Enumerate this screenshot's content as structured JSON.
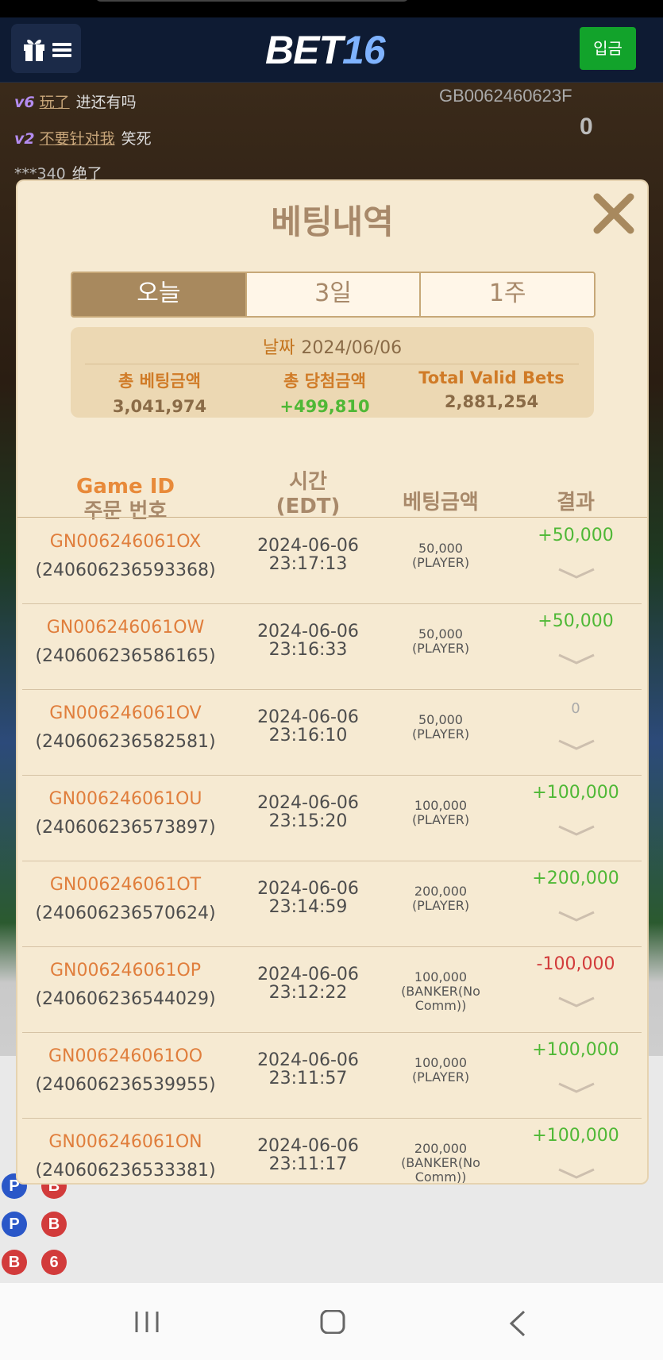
{
  "header": {
    "logo_part1": "BET",
    "logo_part2": "16",
    "deposit_label": "입금"
  },
  "background": {
    "chat": [
      {
        "vip": "v6",
        "name": "玩了",
        "text": "进还有吗"
      },
      {
        "vip": "v2",
        "name": "不要针对我",
        "text": "笑死"
      },
      {
        "vip": "",
        "name": "***340",
        "text": "绝了"
      }
    ],
    "game_code": "GB0062460623F",
    "chip_count": "0"
  },
  "modal": {
    "title": "베팅내역",
    "tabs": [
      {
        "label": "오늘",
        "active": true
      },
      {
        "label": "3일",
        "active": false
      },
      {
        "label": "1주",
        "active": false
      }
    ],
    "summary": {
      "date_label": "날짜",
      "date_value": "2024/06/06",
      "total_bet_label": "총 베팅금액",
      "total_bet_value": "3,041,974",
      "total_win_label": "총 당첨금액",
      "total_win_value": "+499,810",
      "valid_label": "Total Valid Bets",
      "valid_value": "2,881,254"
    },
    "columns": {
      "game_id": "Game ID",
      "order_no": "주문 번호",
      "time": "시간",
      "time_zone": "(EDT)",
      "bet_amount": "베팅금액",
      "result": "결과"
    },
    "rows": [
      {
        "game_id": "GN006246061OX",
        "order": "(240606236593368)",
        "date": "2024-06-06",
        "time": "23:17:13",
        "amount": "50,000",
        "bet_on": "(PLAYER)",
        "bet_on2": "",
        "result": "+50,000",
        "result_type": "pos"
      },
      {
        "game_id": "GN006246061OW",
        "order": "(240606236586165)",
        "date": "2024-06-06",
        "time": "23:16:33",
        "amount": "50,000",
        "bet_on": "(PLAYER)",
        "bet_on2": "",
        "result": "+50,000",
        "result_type": "pos"
      },
      {
        "game_id": "GN006246061OV",
        "order": "(240606236582581)",
        "date": "2024-06-06",
        "time": "23:16:10",
        "amount": "50,000",
        "bet_on": "(PLAYER)",
        "bet_on2": "",
        "result": "0",
        "result_type": "zero"
      },
      {
        "game_id": "GN006246061OU",
        "order": "(240606236573897)",
        "date": "2024-06-06",
        "time": "23:15:20",
        "amount": "100,000",
        "bet_on": "(PLAYER)",
        "bet_on2": "",
        "result": "+100,000",
        "result_type": "pos"
      },
      {
        "game_id": "GN006246061OT",
        "order": "(240606236570624)",
        "date": "2024-06-06",
        "time": "23:14:59",
        "amount": "200,000",
        "bet_on": "(PLAYER)",
        "bet_on2": "",
        "result": "+200,000",
        "result_type": "pos"
      },
      {
        "game_id": "GN006246061OP",
        "order": "(240606236544029)",
        "date": "2024-06-06",
        "time": "23:12:22",
        "amount": "100,000",
        "bet_on": "(BANKER(No",
        "bet_on2": "Comm))",
        "result": "-100,000",
        "result_type": "neg"
      },
      {
        "game_id": "GN006246061OO",
        "order": "(240606236539955)",
        "date": "2024-06-06",
        "time": "23:11:57",
        "amount": "100,000",
        "bet_on": "(PLAYER)",
        "bet_on2": "",
        "result": "+100,000",
        "result_type": "pos"
      },
      {
        "game_id": "GN006246061ON",
        "order": "(240606236533381)",
        "date": "2024-06-06",
        "time": "23:11:17",
        "amount": "200,000",
        "bet_on": "(BANKER(No",
        "bet_on2": "Comm))",
        "result": "+100,000",
        "result_type": "pos"
      }
    ]
  },
  "colors": {
    "accent_orange": "#e07e3c",
    "positive": "#4fb836",
    "negative": "#d23b3b",
    "modal_bg": "#f6ead2",
    "header_bg": "#0e1b33"
  }
}
